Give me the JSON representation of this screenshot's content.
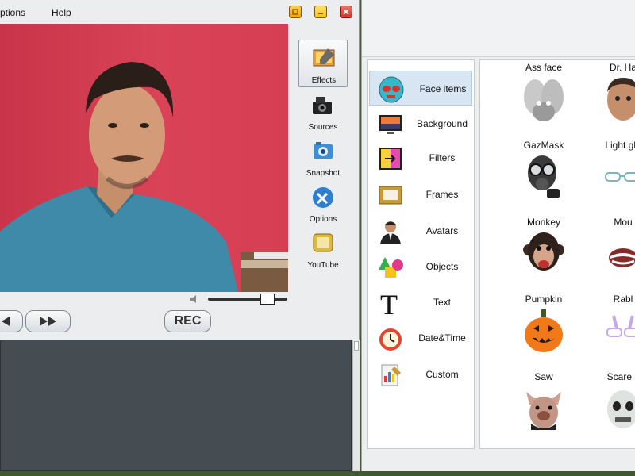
{
  "menu": {
    "options": "ptions",
    "help": "Help"
  },
  "window_buttons": [
    "restore",
    "minimize",
    "close"
  ],
  "tools": [
    {
      "label": "Effects",
      "icon": "effects-icon",
      "active": true
    },
    {
      "label": "Sources",
      "icon": "camera-icon",
      "active": false
    },
    {
      "label": "Snapshot",
      "icon": "snapshot-icon",
      "active": false
    },
    {
      "label": "Options",
      "icon": "options-icon",
      "active": false
    },
    {
      "label": "YouTube",
      "icon": "tv-icon",
      "active": false
    }
  ],
  "transport": {
    "rec_label": "REC"
  },
  "categories": [
    {
      "label": "Face items",
      "icon": "mask-icon",
      "active": true
    },
    {
      "label": "Background",
      "icon": "background-icon",
      "active": false
    },
    {
      "label": "Filters",
      "icon": "filters-icon",
      "active": false
    },
    {
      "label": "Frames",
      "icon": "frame-icon",
      "active": false
    },
    {
      "label": "Avatars",
      "icon": "avatar-icon",
      "active": false
    },
    {
      "label": "Objects",
      "icon": "objects-icon",
      "active": false
    },
    {
      "label": "Text",
      "icon": "text-icon",
      "active": false
    },
    {
      "label": "Date&Time",
      "icon": "clock-icon",
      "active": false
    },
    {
      "label": "Custom",
      "icon": "custom-icon",
      "active": false
    }
  ],
  "face_items": [
    {
      "label": "Ass face",
      "icon": "ass-face-icon"
    },
    {
      "label": "Dr. Ha",
      "icon": "dr-house-icon"
    },
    {
      "label": "GazMask",
      "icon": "gas-mask-icon"
    },
    {
      "label": "Light gla",
      "icon": "light-glasses-icon"
    },
    {
      "label": "Monkey",
      "icon": "monkey-icon"
    },
    {
      "label": "Mou",
      "icon": "mouth-icon"
    },
    {
      "label": "Pumpkin",
      "icon": "pumpkin-icon"
    },
    {
      "label": "Rabl",
      "icon": "rabbit-glasses-icon"
    },
    {
      "label": "Saw",
      "icon": "saw-icon"
    },
    {
      "label": "Scare s",
      "icon": "scare-icon"
    }
  ],
  "colors": {
    "video_bg": "#d23a4e",
    "active_cat": "#d8e6f3",
    "log_bg": "#454c52"
  }
}
